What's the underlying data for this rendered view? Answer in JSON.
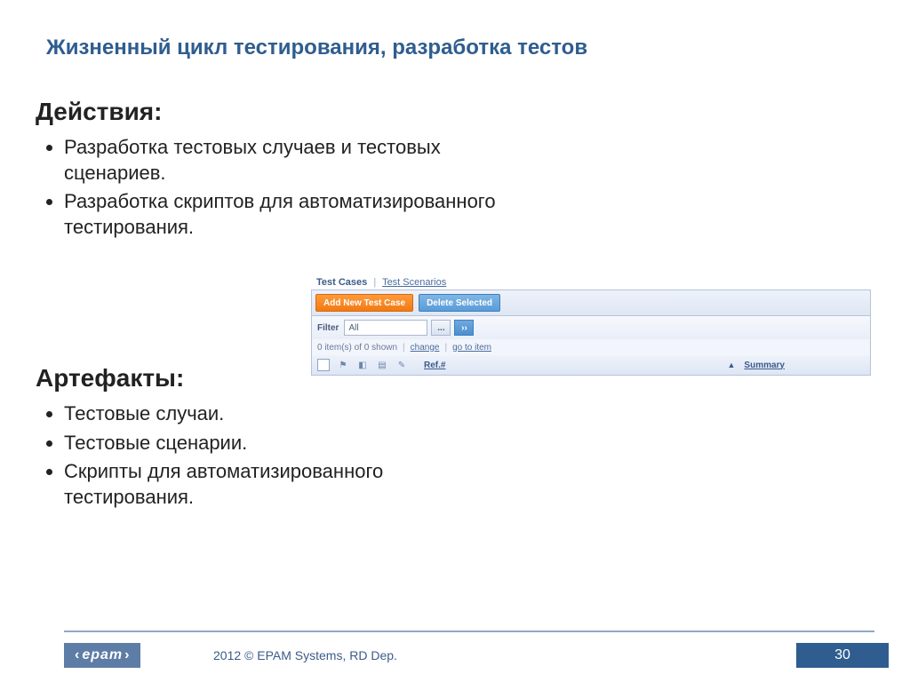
{
  "title": "Жизненный цикл тестирования, разработка тестов",
  "actions": {
    "heading": "Действия:",
    "items": [
      "Разработка тестовых случаев и тестовых сценариев.",
      "Разработка скриптов для автоматизированного тестирования."
    ]
  },
  "artefacts": {
    "heading": "Артефакты:",
    "items": [
      "Тестовые случаи.",
      "Тестовые сценарии.",
      "Скрипты для автоматизированного тестирования."
    ]
  },
  "app": {
    "tabs": {
      "active": "Test Cases",
      "inactive": "Test Scenarios",
      "sep": "|"
    },
    "toolbar": {
      "add": "Add New Test Case",
      "delete": "Delete Selected"
    },
    "filter": {
      "label": "Filter",
      "selected": "All",
      "more": "...",
      "go": "››"
    },
    "status": {
      "shown": "0 item(s) of 0 shown",
      "sep": "|",
      "change": "change",
      "goto": "go to item"
    },
    "header": {
      "col_ref": "Ref.#",
      "col_summary": "Summary"
    }
  },
  "footer": {
    "logo": "epam",
    "copyright": "2012 © EPAM Systems, RD Dep.",
    "page": "30"
  }
}
